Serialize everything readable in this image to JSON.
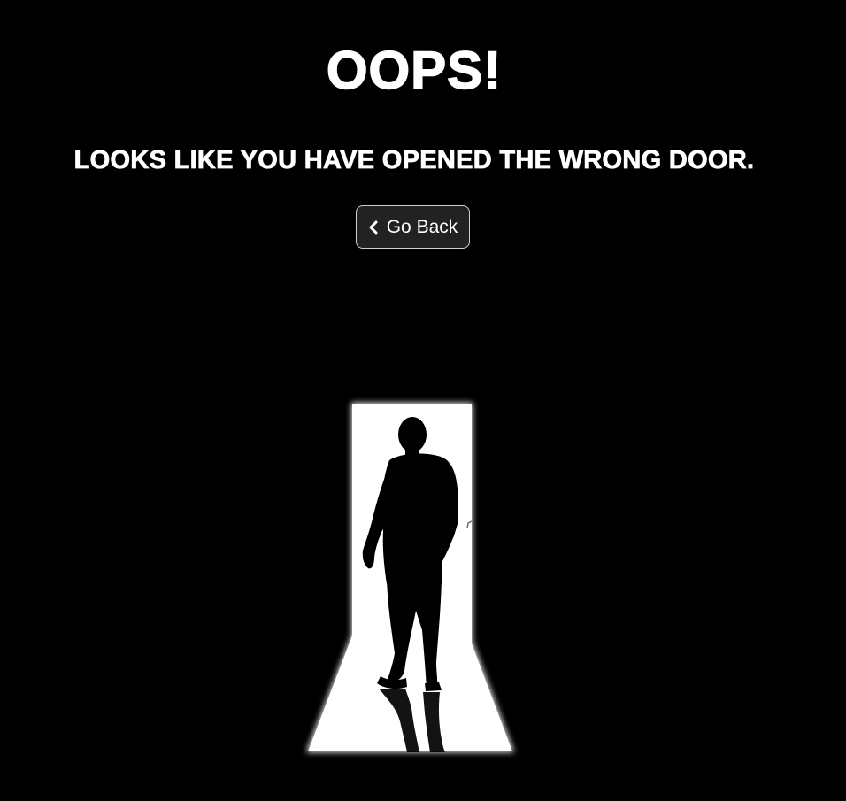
{
  "error": {
    "title": "OOPS!",
    "message": "LOOKS LIKE YOU HAVE OPENED THE WRONG DOOR."
  },
  "back_button": {
    "label": "Go Back",
    "icon": "chevron-left-icon"
  },
  "illustration": {
    "subject": "silhouette of a person standing in a lit doorway",
    "colors": {
      "background": "#000000",
      "door_light": "#ffffff",
      "silhouette": "#000000"
    }
  }
}
